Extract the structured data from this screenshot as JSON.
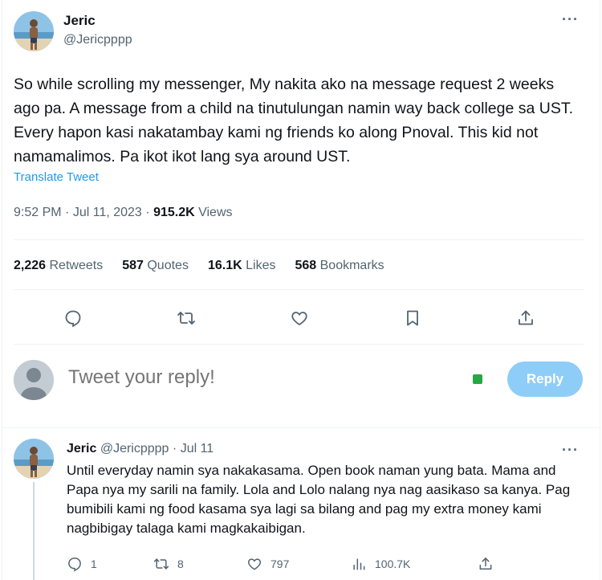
{
  "tweet": {
    "author_name": "Jeric",
    "author_handle": "@Jericpppp",
    "more_icon": "more-dots-icon",
    "text": "So while scrolling my messenger, My nakita ako na message request 2 weeks ago pa. A message from a child na tinutulungan namin way back college sa UST. Every hapon kasi nakatambay kami ng friends ko along Pnoval. This kid not namamalimos. Pa ikot ikot lang sya around UST.",
    "translate_label": "Translate Tweet",
    "time": "9:52 PM",
    "date": "Jul 11, 2023",
    "views_count": "915.2K",
    "views_label": "Views",
    "stats": {
      "retweets_count": "2,226",
      "retweets_label": "Retweets",
      "quotes_count": "587",
      "quotes_label": "Quotes",
      "likes_count": "16.1K",
      "likes_label": "Likes",
      "bookmarks_count": "568",
      "bookmarks_label": "Bookmarks"
    },
    "actions": [
      "reply-icon",
      "retweet-icon",
      "like-icon",
      "bookmark-icon",
      "share-icon"
    ]
  },
  "composer": {
    "placeholder": "Tweet your reply!",
    "reply_button": "Reply",
    "accent": "#1d9bf0",
    "button_color": "#8ecdf8"
  },
  "reply": {
    "author_name": "Jeric",
    "author_handle": "@Jericpppp",
    "separator": "·",
    "date": "Jul 11",
    "text": "Until everyday namin sya nakakasama. Open book naman yung bata. Mama and Papa nya my sarili na family. Lola and Lolo nalang nya nag aasikaso sa kanya. Pag bumibili kami ng food kasama sya lagi sa bilang and pag my extra money kami nagbibigay talaga kami magkakaibigan.",
    "replies": "1",
    "retweets": "8",
    "likes": "797",
    "views": "100.7K"
  }
}
